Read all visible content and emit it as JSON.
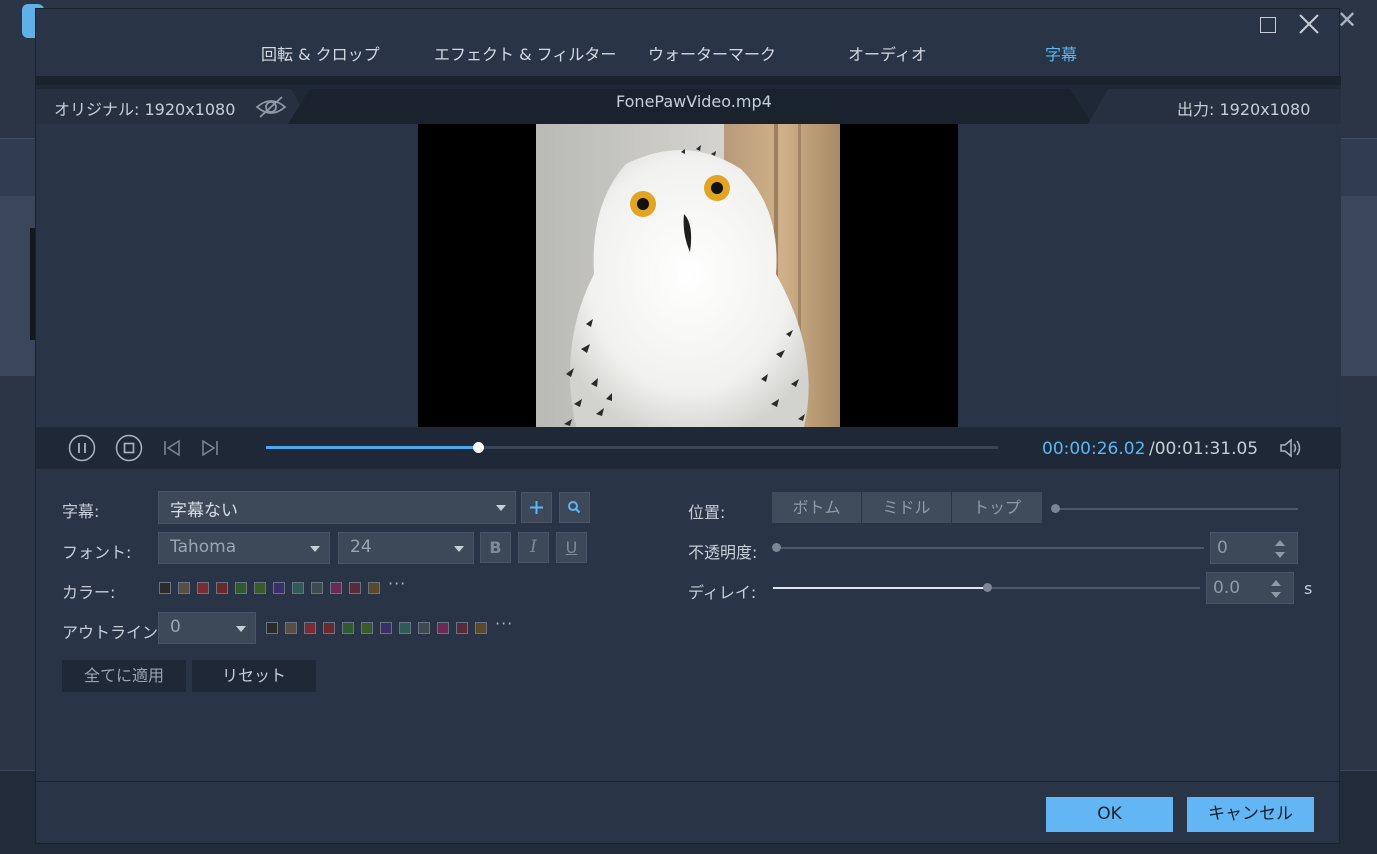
{
  "tabs": [
    "回転 & クロップ",
    "エフェクト & フィルター",
    "ウォーターマーク",
    "オーディオ",
    "字幕"
  ],
  "active_tab": "字幕",
  "info": {
    "original_label": "オリジナル: 1920x1080",
    "file_name": "FonePawVideo.mp4",
    "output_label": "出力: 1920x1080"
  },
  "playback": {
    "current_time": "00:00:26.02",
    "total_time": "/00:01:31.05",
    "progress": 0.29
  },
  "subtitle": {
    "label": "字幕:",
    "value": "字幕ない"
  },
  "font": {
    "label": "フォント:",
    "family": "Tahoma",
    "size": "24",
    "bold": "B",
    "italic": "I",
    "underline": "U"
  },
  "color": {
    "label": "カラー:",
    "swatches": [
      "#2b2b2b",
      "#5a4d44",
      "#7a2b34",
      "#6a2a2a",
      "#2f5a2f",
      "#3a5a2a",
      "#3a2f6a",
      "#2f5a55",
      "#3f4a4f",
      "#6a2a55",
      "#5a2a3a",
      "#5a4a2a"
    ],
    "more": "···"
  },
  "outline": {
    "label": "アウトライン:",
    "value": "0",
    "swatches": [
      "#2b2b2b",
      "#5a4d44",
      "#7a2b34",
      "#6a2a2a",
      "#2f5a2f",
      "#3a5a2a",
      "#3a2f6a",
      "#2f5a55",
      "#3f4a4f",
      "#6a2a55",
      "#5a2a3a",
      "#5a4a2a"
    ],
    "more": "···"
  },
  "buttons": {
    "apply_all": "全てに適用",
    "reset": "リセット",
    "ok": "OK",
    "cancel": "キャンセル"
  },
  "position": {
    "label": "位置:",
    "options": [
      "ボトム",
      "ミドル",
      "トップ"
    ],
    "slider": 0.0
  },
  "opacity": {
    "label": "不透明度:",
    "value": "0",
    "slider": 0.0
  },
  "delay": {
    "label": "ディレイ:",
    "value": "0.0",
    "unit": "s",
    "slider": 0.5
  },
  "colors": {
    "accent": "#5bb6f5",
    "primary_button": "#62b6f4",
    "background": "#2a3447"
  }
}
